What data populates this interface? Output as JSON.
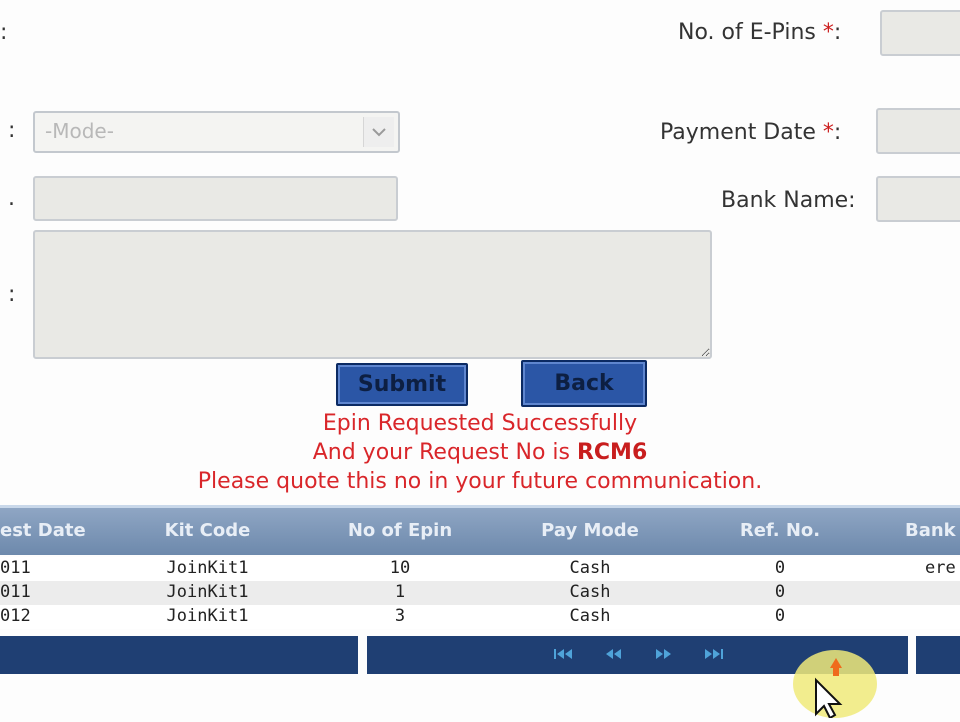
{
  "form": {
    "left_colon_1": ":",
    "left_colon_2": ":",
    "left_colon_3": ".",
    "left_colon_4": ":",
    "epins_label": "No. of E-Pins",
    "epins_req": "*",
    "epins_colon": ":",
    "epins_value": "",
    "mode_placeholder": "-Mode-",
    "payment_date_label": "Payment Date",
    "payment_date_req": "*",
    "payment_date_colon": ":",
    "payment_date_value": "",
    "bank_name_label": "Bank Name:",
    "bank_name_value": "",
    "ref_value": "",
    "remarks_value": ""
  },
  "buttons": {
    "submit_label": "Submit",
    "back_label": "Back"
  },
  "message": {
    "line1": "Epin Requested Successfully",
    "line2_prefix": "And your Request No is ",
    "request_no": "RCM6",
    "line3": "Please quote this no in your future communication."
  },
  "table": {
    "headers": [
      "est Date",
      "Kit Code",
      "No of Epin",
      "Pay Mode",
      "Ref. No.",
      "Bank"
    ],
    "rows": [
      [
        "011",
        "JoinKit1",
        "10",
        "Cash",
        "0",
        "ere"
      ],
      [
        "011",
        "JoinKit1",
        "1",
        "Cash",
        "0",
        ""
      ],
      [
        "012",
        "JoinKit1",
        "3",
        "Cash",
        "0",
        ""
      ]
    ]
  },
  "pager": {
    "icons": [
      "first-page-icon",
      "prev-page-icon",
      "next-page-icon",
      "last-page-icon"
    ]
  },
  "colors": {
    "accent": "#2b56a6",
    "error": "#d9262a",
    "grid_header": "#7f98b9",
    "pager": "#1f3f73"
  }
}
